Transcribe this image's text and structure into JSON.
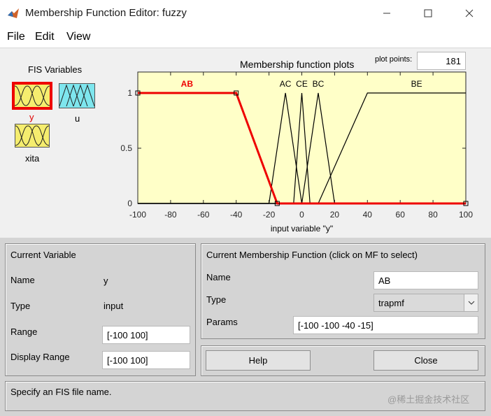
{
  "window": {
    "title": "Membership Function Editor: fuzzy"
  },
  "menu": {
    "file": "File",
    "edit": "Edit",
    "view": "View"
  },
  "fis_variables": {
    "header": "FIS Variables",
    "items": [
      {
        "label": "y",
        "selected": true,
        "kind": "output-style",
        "color": "#f5ed6e",
        "label_color": "#e00000"
      },
      {
        "label": "u",
        "selected": false,
        "kind": "output",
        "color": "#7ee6ee",
        "label_color": "#000000"
      },
      {
        "label": "xita",
        "selected": false,
        "kind": "input",
        "color": "#f5ed6e",
        "label_color": "#000000"
      }
    ]
  },
  "plot": {
    "title": "Membership function plots",
    "plot_points_label": "plot points:",
    "plot_points_value": "181",
    "xlabel": "input variable \"y\"",
    "x_ticks": [
      "-100",
      "-80",
      "-60",
      "-40",
      "-20",
      "0",
      "20",
      "40",
      "60",
      "80",
      "100"
    ],
    "y_ticks": [
      "0",
      "0.5",
      "1"
    ],
    "background": "#ffffc8",
    "highlight_color": "#ee0000"
  },
  "chart_data": {
    "type": "line",
    "title": "Membership function plots",
    "xlabel": "input variable \"y\"",
    "ylabel": "",
    "xlim": [
      -100,
      100
    ],
    "ylim": [
      0,
      1
    ],
    "series": [
      {
        "name": "AB",
        "shape": "trapmf",
        "points": [
          [
            -100,
            1
          ],
          [
            -40,
            1
          ],
          [
            -15,
            0
          ],
          [
            100,
            0
          ]
        ],
        "selected": true
      },
      {
        "name": "AC",
        "shape": "trimf",
        "points": [
          [
            -100,
            0
          ],
          [
            -20,
            0
          ],
          [
            -10,
            1
          ],
          [
            0,
            0
          ],
          [
            100,
            0
          ]
        ],
        "selected": false
      },
      {
        "name": "CE",
        "shape": "trimf",
        "points": [
          [
            -100,
            0
          ],
          [
            -5,
            0
          ],
          [
            0,
            1
          ],
          [
            5,
            0
          ],
          [
            100,
            0
          ]
        ],
        "selected": false
      },
      {
        "name": "BC",
        "shape": "trimf",
        "points": [
          [
            -100,
            0
          ],
          [
            0,
            0
          ],
          [
            10,
            1
          ],
          [
            20,
            0
          ],
          [
            100,
            0
          ]
        ],
        "selected": false
      },
      {
        "name": "BE",
        "shape": "trapmf",
        "points": [
          [
            -100,
            0
          ],
          [
            10,
            0
          ],
          [
            40,
            1
          ],
          [
            100,
            1
          ]
        ],
        "selected": false
      }
    ]
  },
  "current_variable": {
    "header": "Current Variable",
    "name_label": "Name",
    "name_value": "y",
    "type_label": "Type",
    "type_value": "input",
    "range_label": "Range",
    "range_value": "[-100 100]",
    "display_range_label": "Display Range",
    "display_range_value": "[-100 100]"
  },
  "current_mf": {
    "header": "Current Membership Function (click on MF to select)",
    "name_label": "Name",
    "name_value": "AB",
    "type_label": "Type",
    "type_value": "trapmf",
    "params_label": "Params",
    "params_value": "[-100 -100 -40 -15]"
  },
  "buttons": {
    "help": "Help",
    "close": "Close"
  },
  "status": {
    "message": "Specify an FIS file name.",
    "watermark": "@稀土掘金技术社区"
  }
}
